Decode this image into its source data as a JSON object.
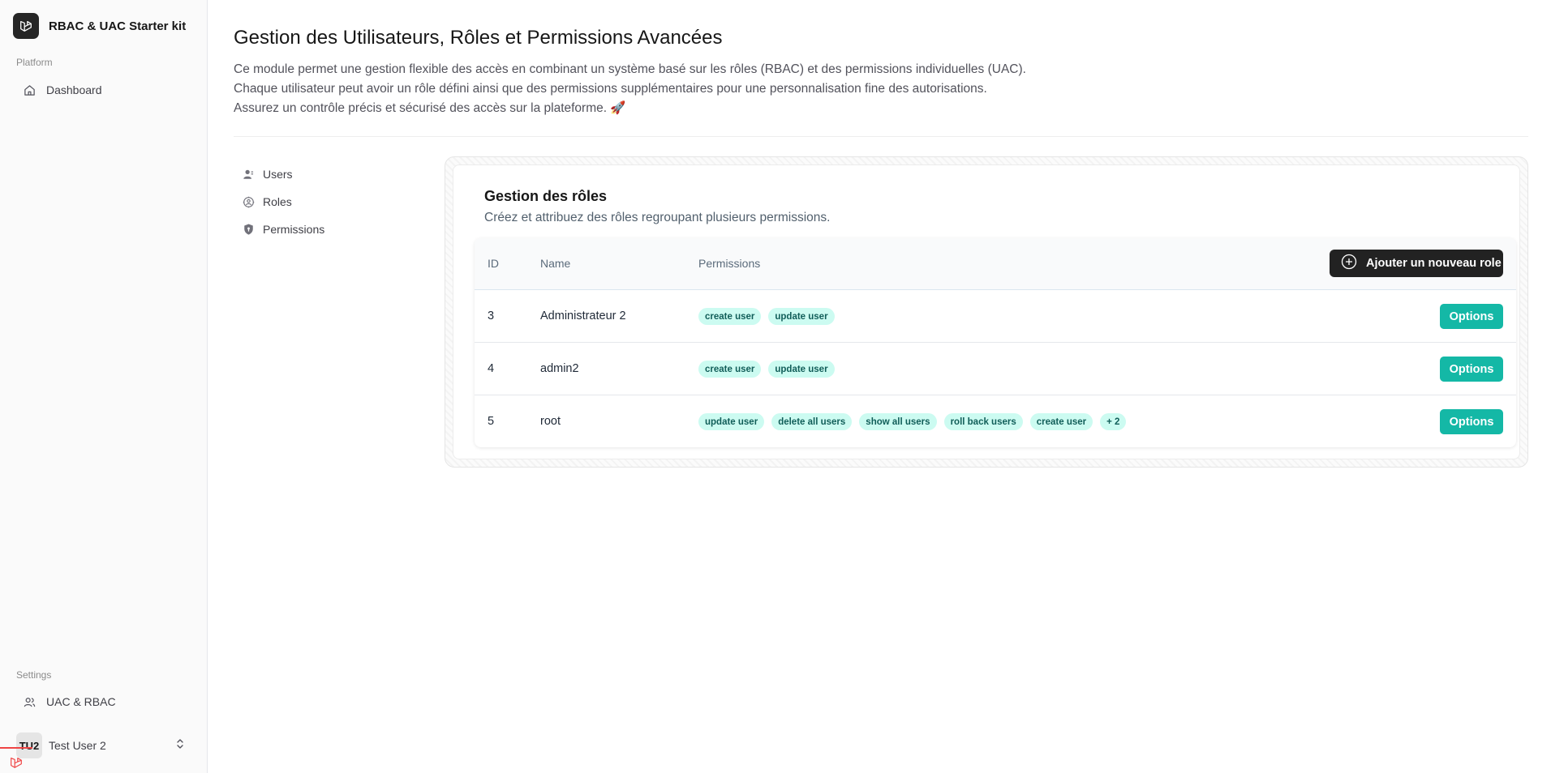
{
  "app": {
    "name": "RBAC & UAC Starter kit"
  },
  "sidebar": {
    "platform_label": "Platform",
    "dashboard_label": "Dashboard",
    "settings_label": "Settings",
    "uac_label": "UAC & RBAC",
    "user": {
      "initials": "TU2",
      "name": "Test User 2"
    }
  },
  "page": {
    "title": "Gestion des Utilisateurs, Rôles et Permissions Avancées",
    "description": [
      "Ce module permet une gestion flexible des accès en combinant un système basé sur les rôles (RBAC) et des permissions individuelles (UAC).",
      "Chaque utilisateur peut avoir un rôle défini ainsi que des permissions supplémentaires pour une personnalisation fine des autorisations.",
      "Assurez un contrôle précis et sécurisé des accès sur la plateforme. 🚀"
    ]
  },
  "subnav": {
    "users": "Users",
    "roles": "Roles",
    "permissions": "Permissions"
  },
  "panel": {
    "title": "Gestion des rôles",
    "subtitle": "Créez et attribuez des rôles regroupant plusieurs permissions.",
    "headers": {
      "id": "ID",
      "name": "Name",
      "permissions": "Permissions"
    },
    "add_button": "Ajouter un nouveau role",
    "options_label": "Options",
    "rows": [
      {
        "id": "3",
        "name": "Administrateur 2",
        "permissions": [
          "create user",
          "update user"
        ]
      },
      {
        "id": "4",
        "name": "admin2",
        "permissions": [
          "create user",
          "update user"
        ]
      },
      {
        "id": "5",
        "name": "root",
        "permissions": [
          "update user",
          "delete all users",
          "show all users",
          "roll back users",
          "create user",
          "+ 2"
        ]
      }
    ]
  },
  "colors": {
    "accent": "#14b8a6",
    "badge_bg": "#ccfbf1",
    "badge_text": "#115e59",
    "dark_button": "#222222"
  }
}
